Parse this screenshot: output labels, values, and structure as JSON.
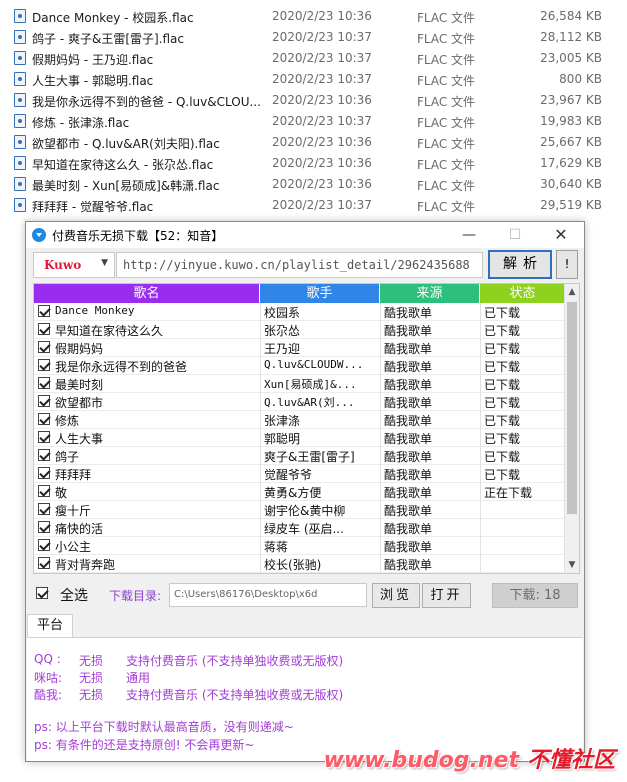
{
  "files": [
    {
      "name": "Dance Monkey - 校园系.flac",
      "date": "2020/2/23 10:36",
      "type": "FLAC 文件",
      "size": "26,584 KB"
    },
    {
      "name": "鸽子 - 爽子&王雷[雷子].flac",
      "date": "2020/2/23 10:37",
      "type": "FLAC 文件",
      "size": "28,112 KB"
    },
    {
      "name": "假期妈妈 - 王乃迎.flac",
      "date": "2020/2/23 10:37",
      "type": "FLAC 文件",
      "size": "23,005 KB"
    },
    {
      "name": "人生大事 - 郭聪明.flac",
      "date": "2020/2/23 10:37",
      "type": "FLAC 文件",
      "size": "800 KB"
    },
    {
      "name": "我是你永远得不到的爸爸 - Q.luv&CLOU...",
      "date": "2020/2/23 10:36",
      "type": "FLAC 文件",
      "size": "23,967 KB"
    },
    {
      "name": "修炼 - 张津涤.flac",
      "date": "2020/2/23 10:37",
      "type": "FLAC 文件",
      "size": "19,983 KB"
    },
    {
      "name": "欲望都市 - Q.luv&AR(刘夫阳).flac",
      "date": "2020/2/23 10:36",
      "type": "FLAC 文件",
      "size": "25,667 KB"
    },
    {
      "name": "早知道在家待这么久 - 张尕怂.flac",
      "date": "2020/2/23 10:36",
      "type": "FLAC 文件",
      "size": "17,629 KB"
    },
    {
      "name": "最美时刻 - Xun[易硕成]&韩潇.flac",
      "date": "2020/2/23 10:36",
      "type": "FLAC 文件",
      "size": "30,640 KB"
    },
    {
      "name": "拜拜拜 - 觉醒爷爷.flac",
      "date": "2020/2/23 10:37",
      "type": "FLAC 文件",
      "size": "29,519 KB"
    }
  ],
  "window": {
    "title": "付费音乐无损下载【52：知音】",
    "min_glyph": "—",
    "max_glyph": "☐",
    "close_glyph": "✕"
  },
  "toolbar": {
    "source_value": "Kuwo",
    "source_arrow": "▼",
    "url_value": "http://yinyue.kuwo.cn/playlist_detail/2962435688",
    "parse_label": "解析",
    "bang_label": "!"
  },
  "table": {
    "headers": {
      "name": "歌名",
      "artist": "歌手",
      "source": "来源",
      "status": "状态"
    },
    "rows": [
      {
        "name": "Dance Monkey",
        "artist": "校园系",
        "source": "酷我歌单",
        "status": "已下载"
      },
      {
        "name": "早知道在家待这么久",
        "artist": "张尕怂",
        "source": "酷我歌单",
        "status": "已下载"
      },
      {
        "name": "假期妈妈",
        "artist": "王乃迎",
        "source": "酷我歌单",
        "status": "已下载"
      },
      {
        "name": "我是你永远得不到的爸爸",
        "artist": "Q.luv&CLOUDW...",
        "source": "酷我歌单",
        "status": "已下载"
      },
      {
        "name": "最美时刻",
        "artist": "Xun[易硕成]&...",
        "source": "酷我歌单",
        "status": "已下载"
      },
      {
        "name": "欲望都市",
        "artist": "Q.luv&AR(刘...",
        "source": "酷我歌单",
        "status": "已下载"
      },
      {
        "name": "修炼",
        "artist": "张津涤",
        "source": "酷我歌单",
        "status": "已下载"
      },
      {
        "name": "人生大事",
        "artist": "郭聪明",
        "source": "酷我歌单",
        "status": "已下载"
      },
      {
        "name": "鸽子",
        "artist": "爽子&王雷[雷子]",
        "source": "酷我歌单",
        "status": "已下载"
      },
      {
        "name": "拜拜拜",
        "artist": "觉醒爷爷",
        "source": "酷我歌单",
        "status": "已下载"
      },
      {
        "name": "敬",
        "artist": "黄勇&方便",
        "source": "酷我歌单",
        "status": "正在下载"
      },
      {
        "name": "瘦十斤",
        "artist": "谢宇伦&黄中柳",
        "source": "酷我歌单",
        "status": ""
      },
      {
        "name": "痛快的活",
        "artist": "绿皮车 (巫启...",
        "source": "酷我歌单",
        "status": ""
      },
      {
        "name": "小公主",
        "artist": "蒋蒋",
        "source": "酷我歌单",
        "status": ""
      },
      {
        "name": "背对背奔跑",
        "artist": "校长(张驰)",
        "source": "酷我歌单",
        "status": ""
      }
    ],
    "scroll_up": "▲",
    "scroll_down": "▼"
  },
  "bottom": {
    "select_all_label": "全选",
    "dir_label": "下载目录:",
    "dir_value": "C:\\Users\\86176\\Desktop\\x6d",
    "browse_label": "浏览",
    "open_label": "打开",
    "download_label": "下载: 18"
  },
  "tabs": {
    "platform": "平台"
  },
  "info": {
    "platforms": [
      {
        "name": "QQ :",
        "quality": "无损",
        "note": "支持付费音乐 (不支持单独收费或无版权)"
      },
      {
        "name": "咪咕:",
        "quality": "无损",
        "note": "通用"
      },
      {
        "name": "酷我:",
        "quality": "无损",
        "note": "支持付费音乐 (不支持单独收费或无版权)"
      }
    ],
    "ps1": "ps: 以上平台下载时默认最高音质，没有则递减~",
    "ps2": "ps: 有条件的还是支持原创! 不会再更新~"
  },
  "watermark": {
    "url": "www.budog.net",
    "cn": "不懂社区"
  }
}
